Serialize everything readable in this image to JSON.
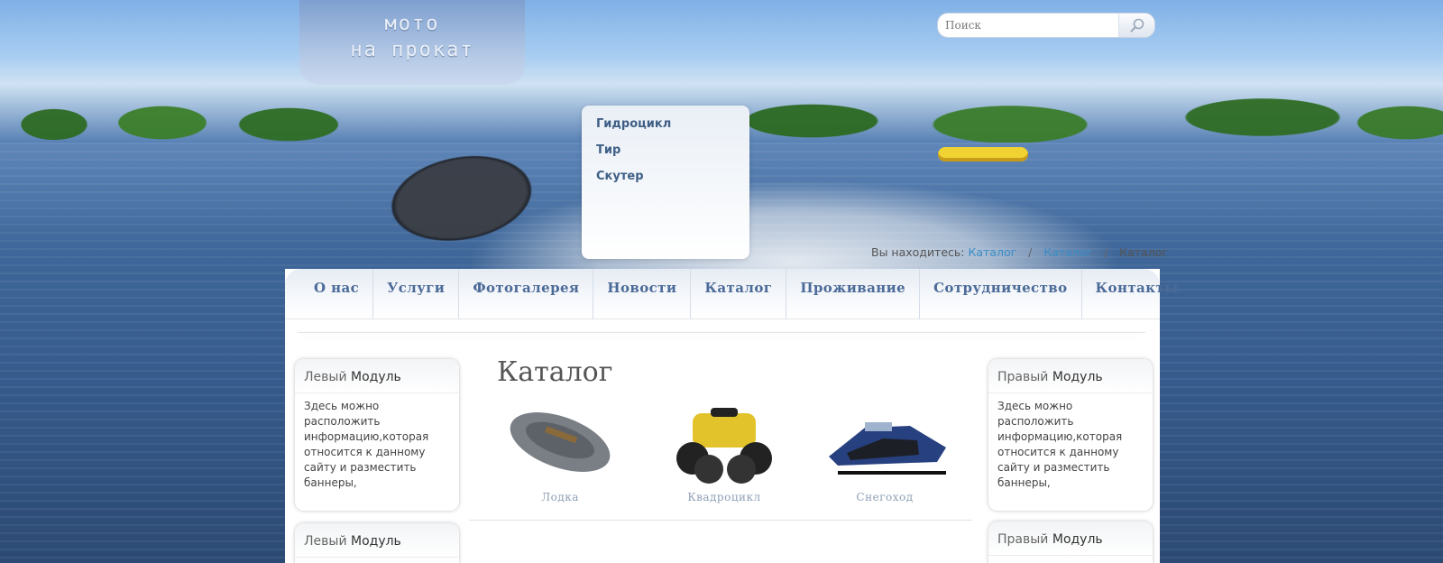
{
  "logo": {
    "line1": "мото",
    "line2": "на прокат"
  },
  "search": {
    "placeholder": "Поиск"
  },
  "dropdown": {
    "items": [
      "Гидроцикл",
      "Тир",
      "Скутер"
    ]
  },
  "breadcrumb": {
    "prefix": "Вы находитесь:",
    "items": [
      "Каталог",
      "Каталог",
      "Каталог"
    ],
    "separator": "/"
  },
  "nav": {
    "items": [
      "О нас",
      "Услуги",
      "Фотогалерея",
      "Новости",
      "Каталог",
      "Проживание",
      "Сотрудничество",
      "Контакты"
    ]
  },
  "left_modules": [
    {
      "title_a": "Левый",
      "title_b": "Модуль",
      "body": "Здесь можно расположить информацию,которая относится к данному сайту и разместить баннеры,"
    },
    {
      "title_a": "Левый",
      "title_b": "Модуль"
    }
  ],
  "right_modules": [
    {
      "title_a": "Правый",
      "title_b": "Модуль",
      "body": "Здесь можно расположить информацию,которая относится к данному сайту и разместить баннеры,"
    },
    {
      "title_a": "Правый",
      "title_b": "Модуль"
    }
  ],
  "catalog": {
    "title": "Каталог",
    "items": [
      {
        "label": "Лодка",
        "icon": "boat-icon"
      },
      {
        "label": "Квадроцикл",
        "icon": "atv-icon"
      },
      {
        "label": "Снегоход",
        "icon": "snowmobile-icon"
      }
    ]
  },
  "colors": {
    "nav_text": "#4b6a98",
    "link": "#3a8ec8",
    "menu_text": "#3f5f86"
  }
}
